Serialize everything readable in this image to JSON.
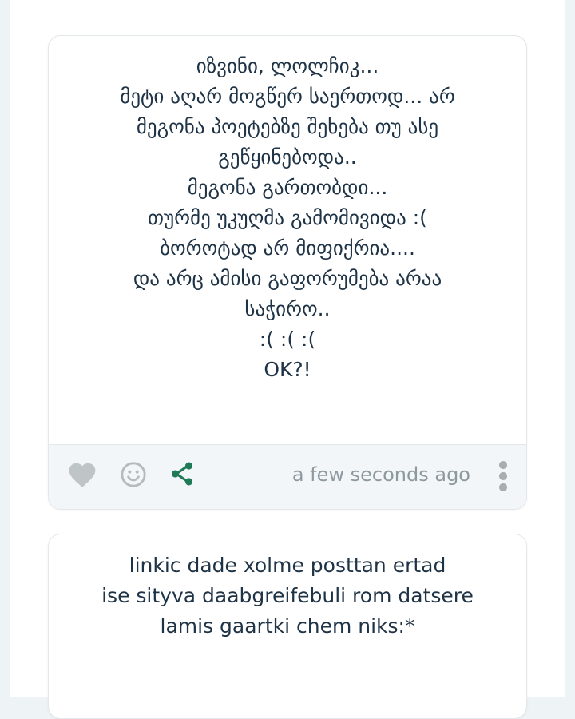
{
  "posts": [
    {
      "lines": [
        "იზვინი, ლოლჩიკ...",
        "მეტი აღარ მოგწერ საერთოდ... არ",
        "მეგონა პოეტებზე შეხება თუ ასე",
        "გეწყინებოდა..",
        "მეგონა გართობდი...",
        "თურმე უკუღმა გამომივიდა :(",
        "ბოროტად არ მიფიქრია....",
        "და არც ამისი გაფორუმება არაა",
        "საჭირო..",
        ":( :( :(",
        "OK?!"
      ],
      "timestamp": "a few seconds ago"
    },
    {
      "lines": [
        "linkic dade xolme posttan ertad",
        "ise sityva daabgreifebuli rom datsere",
        "lamis gaartki chem niks:*"
      ]
    }
  ],
  "colors": {
    "heart": "#bfc4c7",
    "smile": "#b4babd",
    "share": "#1f7a57",
    "more": "#a7adb1",
    "text": "#1f3346",
    "timestamp": "#8d989f"
  },
  "icons": [
    "heart-icon",
    "smile-icon",
    "share-icon",
    "more-vertical-icon"
  ]
}
